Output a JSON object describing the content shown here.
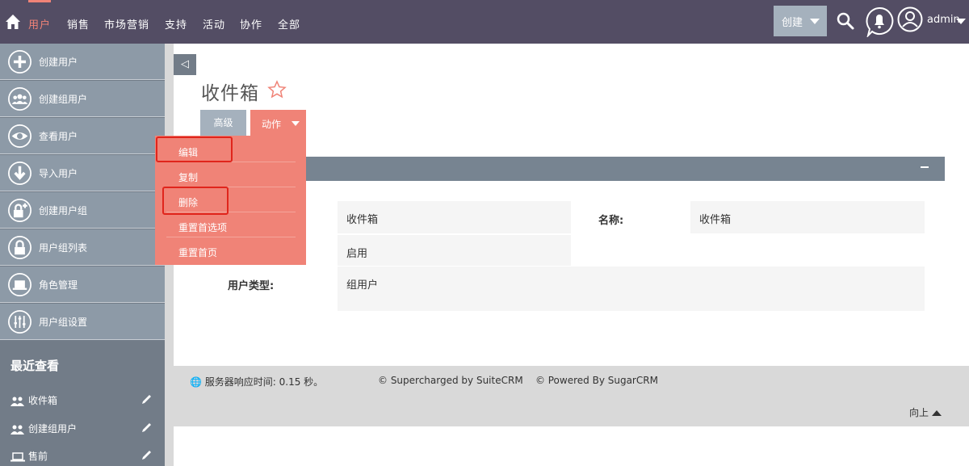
{
  "nav": {
    "items": [
      "用户",
      "销售",
      "市场营销",
      "支持",
      "活动",
      "协作",
      "全部"
    ],
    "create_label": "创建",
    "user_label": "admin"
  },
  "sidebar": {
    "items": [
      {
        "label": "创建用户",
        "icon": "plus-icon"
      },
      {
        "label": "创建组用户",
        "icon": "group-icon"
      },
      {
        "label": "查看用户",
        "icon": "eye-icon"
      },
      {
        "label": "导入用户",
        "icon": "import-icon"
      },
      {
        "label": "创建用户组",
        "icon": "lock-plus-icon"
      },
      {
        "label": "用户组列表",
        "icon": "lock-icon"
      },
      {
        "label": "角色管理",
        "icon": "laptop-icon"
      },
      {
        "label": "用户组设置",
        "icon": "sliders-icon"
      }
    ],
    "recent_title": "最近查看",
    "recent": [
      {
        "label": "收件箱",
        "icon": "group-icon"
      },
      {
        "label": "创建组用户",
        "icon": "group-icon"
      },
      {
        "label": "售前",
        "icon": "laptop-icon"
      }
    ]
  },
  "page": {
    "title": "收件箱",
    "advanced_label": "高级",
    "action_label": "动作"
  },
  "dropdown": {
    "items": [
      "编辑",
      "复制",
      "删除",
      "重置首选项",
      "重置首页"
    ]
  },
  "detail": {
    "v1": "收件箱",
    "name_label": "名称:",
    "name_value": "收件箱",
    "status_value": "启用",
    "type_label": "用户类型:",
    "type_value": "组用户"
  },
  "footer": {
    "response": "服务器响应时间: 0.15 秒。",
    "suite": "© Supercharged by SuiteCRM",
    "sugar": "© Powered By SugarCRM",
    "back_top": "向上"
  },
  "colors": {
    "topbar": "#534d64",
    "accent": "#f08377",
    "sidebar": "#8d9aa7",
    "highlight": "#e0251c"
  }
}
